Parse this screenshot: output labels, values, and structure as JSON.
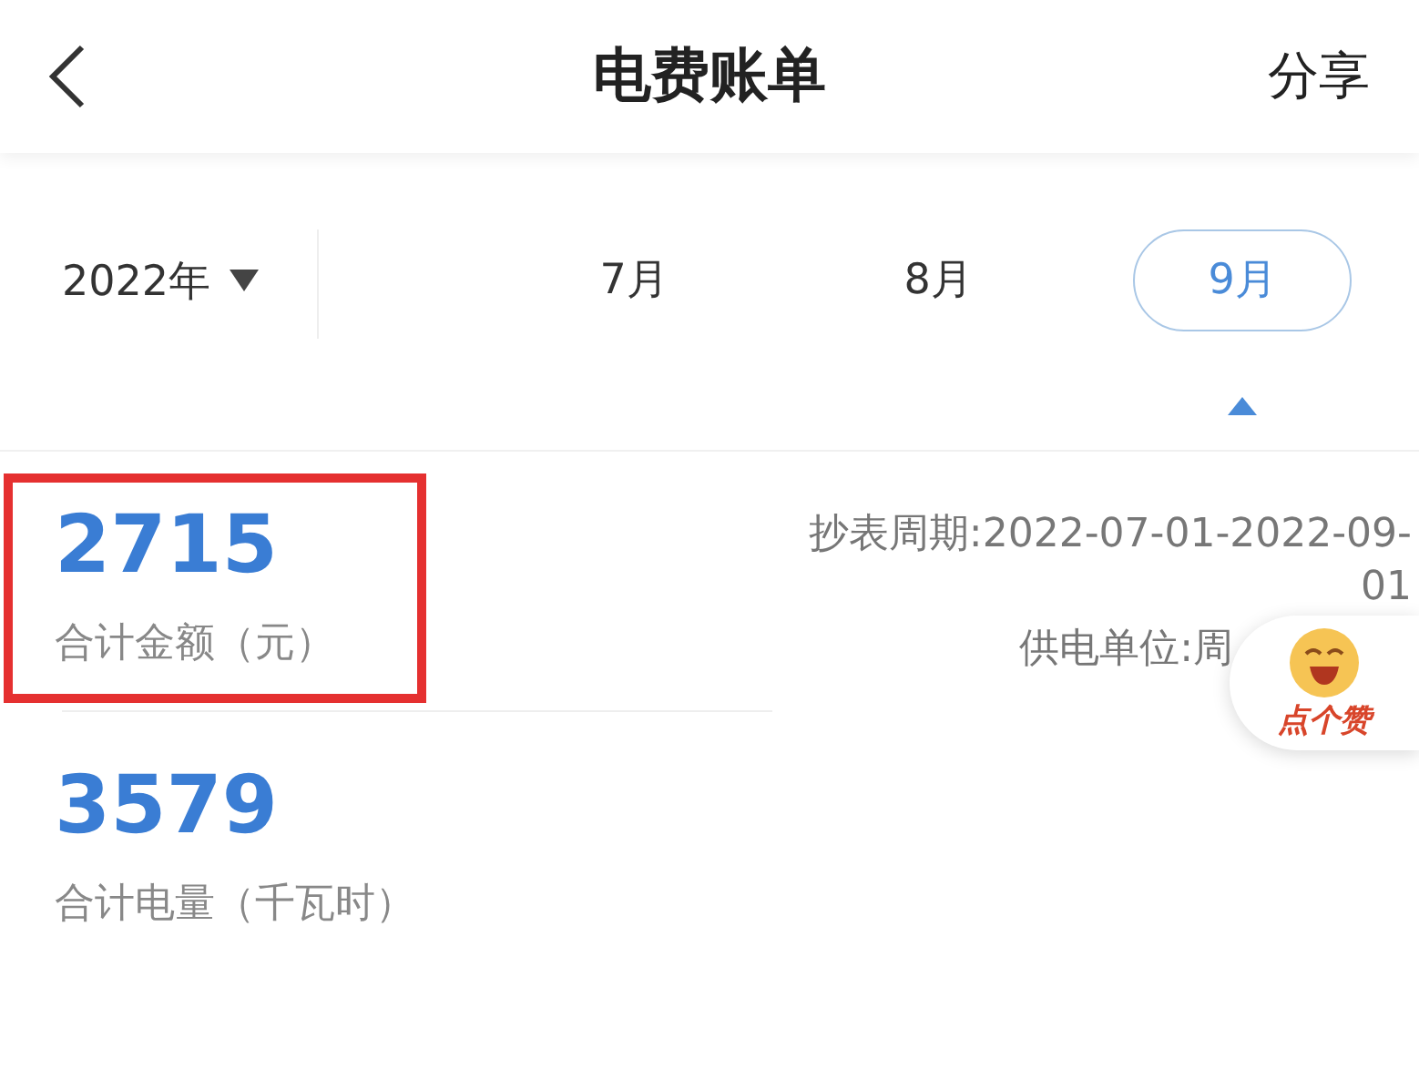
{
  "header": {
    "title": "电费账单",
    "share": "分享"
  },
  "year_picker": {
    "label": "2022年"
  },
  "months": [
    {
      "label": "7月",
      "selected": false
    },
    {
      "label": "8月",
      "selected": false
    },
    {
      "label": "9月",
      "selected": true
    }
  ],
  "stats": [
    {
      "value": "2715",
      "label": "合计金额（元）",
      "highlighted": true
    },
    {
      "value": "3579",
      "label": "合计电量（千瓦时）",
      "highlighted": false
    }
  ],
  "meta": {
    "period": "抄表周期:2022-07-01-2022-09-",
    "period_rest": "01",
    "supplier": "供电单位:周"
  },
  "like_badge": {
    "label": "点个赞"
  }
}
